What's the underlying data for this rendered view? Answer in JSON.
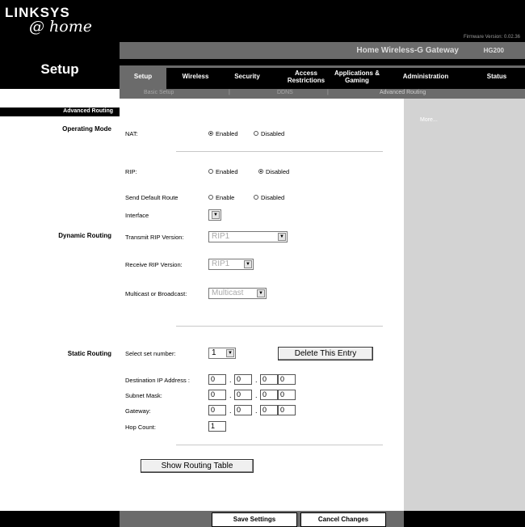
{
  "brand": {
    "line1": "LINKSYS",
    "line2": "@ home"
  },
  "firmware": "Firmware Version: 0.02.36",
  "product_name": "Home Wireless-G Gateway",
  "model": "HG200",
  "section_title": "Setup",
  "tabs": [
    {
      "label": "Setup"
    },
    {
      "label": "Wireless"
    },
    {
      "label": "Security"
    },
    {
      "label": "Access Restrictions"
    },
    {
      "label": "Applications & Gaming"
    },
    {
      "label": "Administration"
    },
    {
      "label": "Status"
    }
  ],
  "subnav": {
    "items": [
      "Basic Setup",
      "DDNS",
      "Advanced Routing"
    ],
    "separator": "|"
  },
  "sidebar": {
    "heading": "Advanced Routing",
    "operating_mode": "Operating Mode",
    "dynamic_routing": "Dynamic Routing",
    "static_routing": "Static Routing"
  },
  "right_panel": {
    "more_link": "More..."
  },
  "nat": {
    "label": "NAT:",
    "enabled": "Enabled",
    "disabled": "Disabled",
    "selected": "Enabled"
  },
  "rip": {
    "label": "RIP:",
    "enabled": "Enabled",
    "disabled": "Disabled",
    "selected": "Disabled"
  },
  "send_default_route": {
    "label": "Send Default Route",
    "enable": "Enable",
    "disabled": "Disabled"
  },
  "interface": {
    "label": "Interface",
    "value": ""
  },
  "transmit_rip": {
    "label": "Transmit RIP Version:",
    "value": "RIP1"
  },
  "receive_rip": {
    "label": "Receive RIP Version:",
    "value": "RIP1"
  },
  "multicast": {
    "label": "Multicast or Broadcast:",
    "value": "Multicast"
  },
  "static": {
    "select_set_label": "Select set number:",
    "set_number": "1",
    "delete_button": "Delete This Entry",
    "dest_ip_label": "Destination IP Address :",
    "dest_ip": [
      "0",
      "0",
      "0",
      "0"
    ],
    "subnet_label": "Subnet Mask:",
    "subnet": [
      "0",
      "0",
      "0",
      "0"
    ],
    "gateway_label": "Gateway:",
    "gateway": [
      "0",
      "0",
      "0",
      "0"
    ],
    "hop_label": "Hop Count:",
    "hop": "1",
    "show_table_button": "Show Routing Table"
  },
  "footer": {
    "save": "Save Settings",
    "cancel": "Cancel Changes"
  }
}
